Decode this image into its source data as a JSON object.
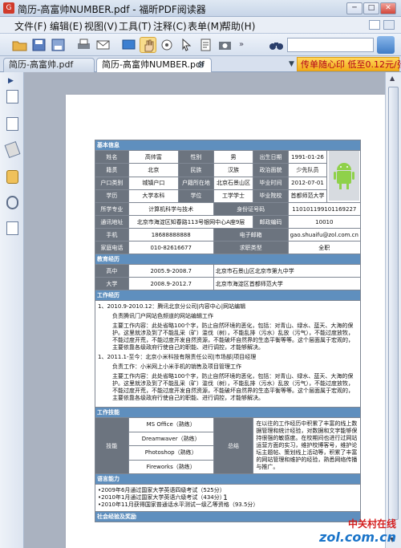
{
  "window": {
    "title": "简历-高富帅NUMBER.pdf - 福昕PDF阅读器",
    "controls": {
      "minimize": "─",
      "maximize": "□",
      "close": "✕"
    }
  },
  "menu": [
    "文件(F)",
    "编辑(E)",
    "视图(V)",
    "工具(T)",
    "注释(C)",
    "表单(M)",
    "帮助(H)"
  ],
  "tabs": [
    {
      "label": "简历-高富帅.pdf",
      "active": false
    },
    {
      "label": "简历-高富帅NUMBER.pdf",
      "active": true
    }
  ],
  "tab_close": "⊗",
  "ad_text": "传单随心印 低至0.12元/张",
  "resume": {
    "sections": {
      "basic": "基本信息",
      "education": "教育经历",
      "work": "工作经历",
      "skills": "工作技能",
      "language": "语言能力",
      "social": "社会经验及奖励"
    },
    "basic": [
      [
        "姓名",
        "高帅富",
        "性别",
        "男",
        "出生日期",
        "1991-01-26"
      ],
      [
        "籍贯",
        "北京",
        "民族",
        "汉族",
        "政治面貌",
        "少先队员"
      ],
      [
        "户口类别",
        "城镇户口",
        "户籍所在地",
        "北京石景山区",
        "毕业时间",
        "2012-07-01"
      ],
      [
        "学历",
        "大学本科",
        "学位",
        "工学学士",
        "毕业院校",
        "首都师范大学"
      ]
    ],
    "major": {
      "label": "所学专业",
      "value": "计算机科学与技术",
      "id_label": "身份证号码",
      "id_value": "110101199101169227"
    },
    "address": {
      "label": "通讯地址",
      "value": "北京市海淀区知春路113号银网中心A座9层",
      "zip_label": "邮政编码",
      "zip_value": "10010"
    },
    "mobile": {
      "label": "手机",
      "value": "18688888888",
      "email_label": "电子邮箱",
      "email_value": "gao.shuaifu@zol.com.cn"
    },
    "home": {
      "label": "家庭电话",
      "value": "010-82616677",
      "status_label": "求职类型",
      "status_value": "全职"
    },
    "education": [
      [
        "高中",
        "2005.9-2008.7",
        "北京市石景山区北京市第九中学"
      ],
      [
        "大学",
        "2008.9-2012.7",
        "北京市海淀区首都师范大学"
      ]
    ],
    "work": [
      "1、2010.9-2010.12：腾讯北京分公司|内容中心|网站编辑",
      "负责腾讯门户网站色频道的网站编辑工作",
      "主要工作内容：此处省略100个字，防止自然环境的恶化，包括：对青山、绿水、蓝天、大海的保护。这里就涉及到了不能乱采（矿）滥伐（树），不能乱排（污水）乱放（污气），不能过度放牧，不能过度开荒，不能过度开发自然资源，不能破坏自然界的生态平衡等等。这个层面属于宏观的，主要依靠各级政府行使自己的职能、进行调控，才能够解决。",
      "1、2011.1-至今：北京小米科技有限责任公司|市场部|项目经理",
      "负责工作：小米网上小米手机的销售及项目管理工作",
      "主要工作内容：此处省略100个字，防止自然环境的恶化，包括：对青山、绿水、蓝天、大海的保护。这里就涉及到了不能乱采（矿）滥伐（树），不能乱排（污水）乱放（污气），不能过度放牧，不能过度开荒，不能过度开发自然资源，不能破坏自然界的生态平衡等等。这个层面属于宏观的，主要依靠各级政府行使自己的职能、进行调控，才能够解决。"
    ],
    "skills": {
      "label": "技能",
      "items": [
        "MS Office（熟练）",
        "Dreamwaver（熟练）",
        "Photoshop（熟练）",
        "Fireworks（熟练）"
      ],
      "summary_label": "总结",
      "summary": "在以往的工作经历中积累了丰富的线上数据管理和统计经验，对数据和文字能够保持很强的敏感度。在校期间也进行过网站运营方面的实习，维护校博客号，维护论坛主题帖、策划线上活动等，积累了丰富的网站管理和维护的经验，熟悉网络传播与推广。"
    },
    "language": [
      "•2009年6月通过国家大学英语四级考试（525分）",
      "•2010年1月通过国家大学英语六级考试（434分）",
      "•2010年11月获得国家普通话水平测试一级乙等资格（93.5分）"
    ]
  },
  "page_number": "1",
  "watermark": {
    "line1": "中关村在线",
    "line2": "zol.com.cn"
  }
}
